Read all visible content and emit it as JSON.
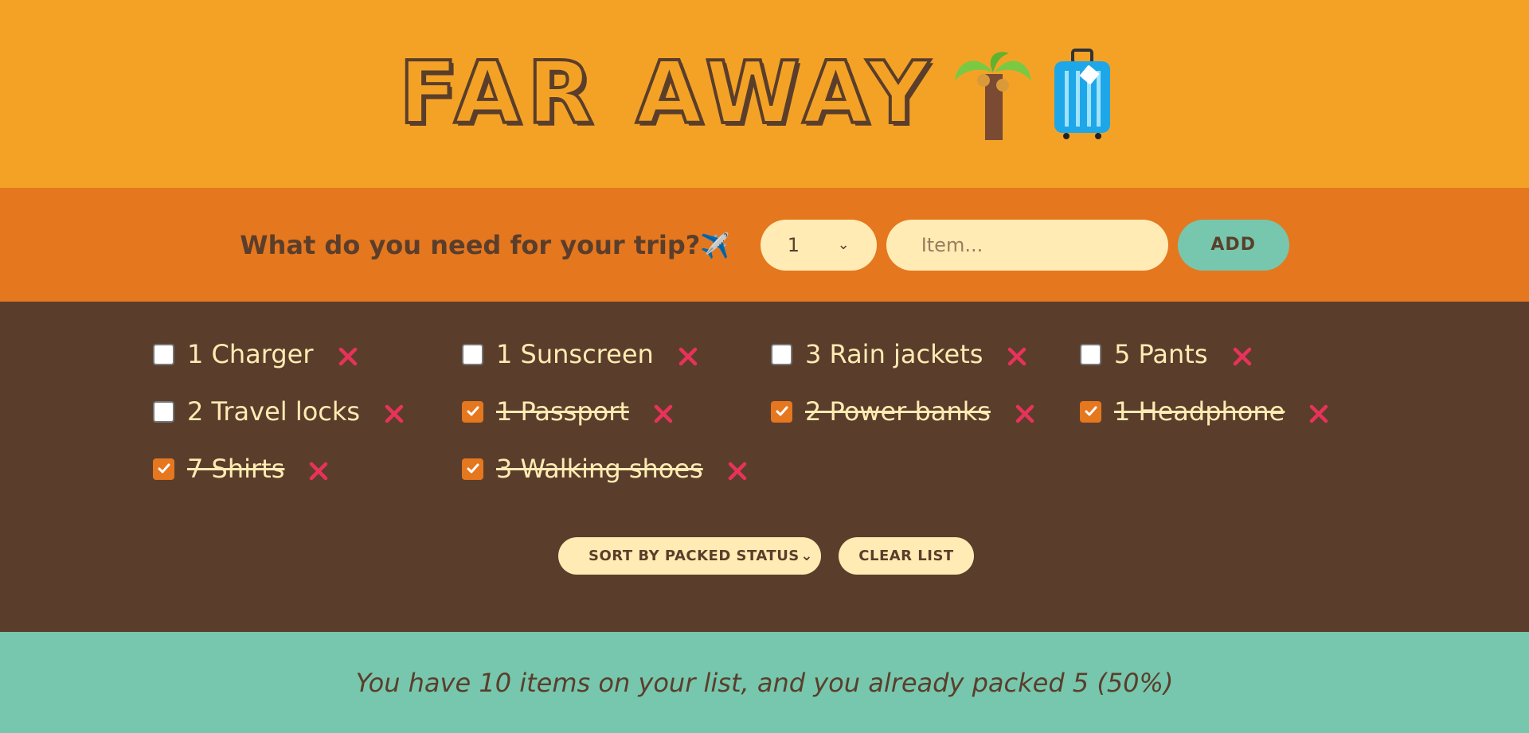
{
  "header": {
    "logo_text": "FAR AWAY",
    "icons": [
      "palm-tree-icon",
      "suitcase-icon"
    ]
  },
  "form": {
    "question": "What do you need for your trip?",
    "question_icon": "airplane-icon",
    "quantity_selected": "1",
    "item_placeholder": "Item...",
    "add_label": "ADD"
  },
  "items": [
    {
      "quantity": 1,
      "description": "Charger",
      "text": "1 Charger",
      "packed": false
    },
    {
      "quantity": 1,
      "description": "Sunscreen",
      "text": "1 Sunscreen",
      "packed": false
    },
    {
      "quantity": 3,
      "description": "Rain jackets",
      "text": "3 Rain jackets",
      "packed": false
    },
    {
      "quantity": 5,
      "description": "Pants",
      "text": "5 Pants",
      "packed": false
    },
    {
      "quantity": 2,
      "description": "Travel locks",
      "text": "2 Travel locks",
      "packed": false
    },
    {
      "quantity": 1,
      "description": "Passport",
      "text": "1 Passport",
      "packed": true
    },
    {
      "quantity": 2,
      "description": "Power banks",
      "text": "2 Power banks",
      "packed": true
    },
    {
      "quantity": 1,
      "description": "Headphone",
      "text": "1 Headphone",
      "packed": true
    },
    {
      "quantity": 7,
      "description": "Shirts",
      "text": "7 Shirts",
      "packed": true
    },
    {
      "quantity": 3,
      "description": "Walking shoes",
      "text": "3 Walking shoes",
      "packed": true
    }
  ],
  "actions": {
    "sort_selected": "SORT BY PACKED STATUS",
    "clear_label": "CLEAR LIST"
  },
  "stats": {
    "text": "You have 10 items on your list, and you already packed 5 (50%)"
  },
  "colors": {
    "header_bg": "#f4a226",
    "form_bg": "#e5771f",
    "list_bg": "#5a3e2b",
    "stats_bg": "#76c7ad",
    "cream": "#ffebb3",
    "delete_red": "#e8325a"
  }
}
